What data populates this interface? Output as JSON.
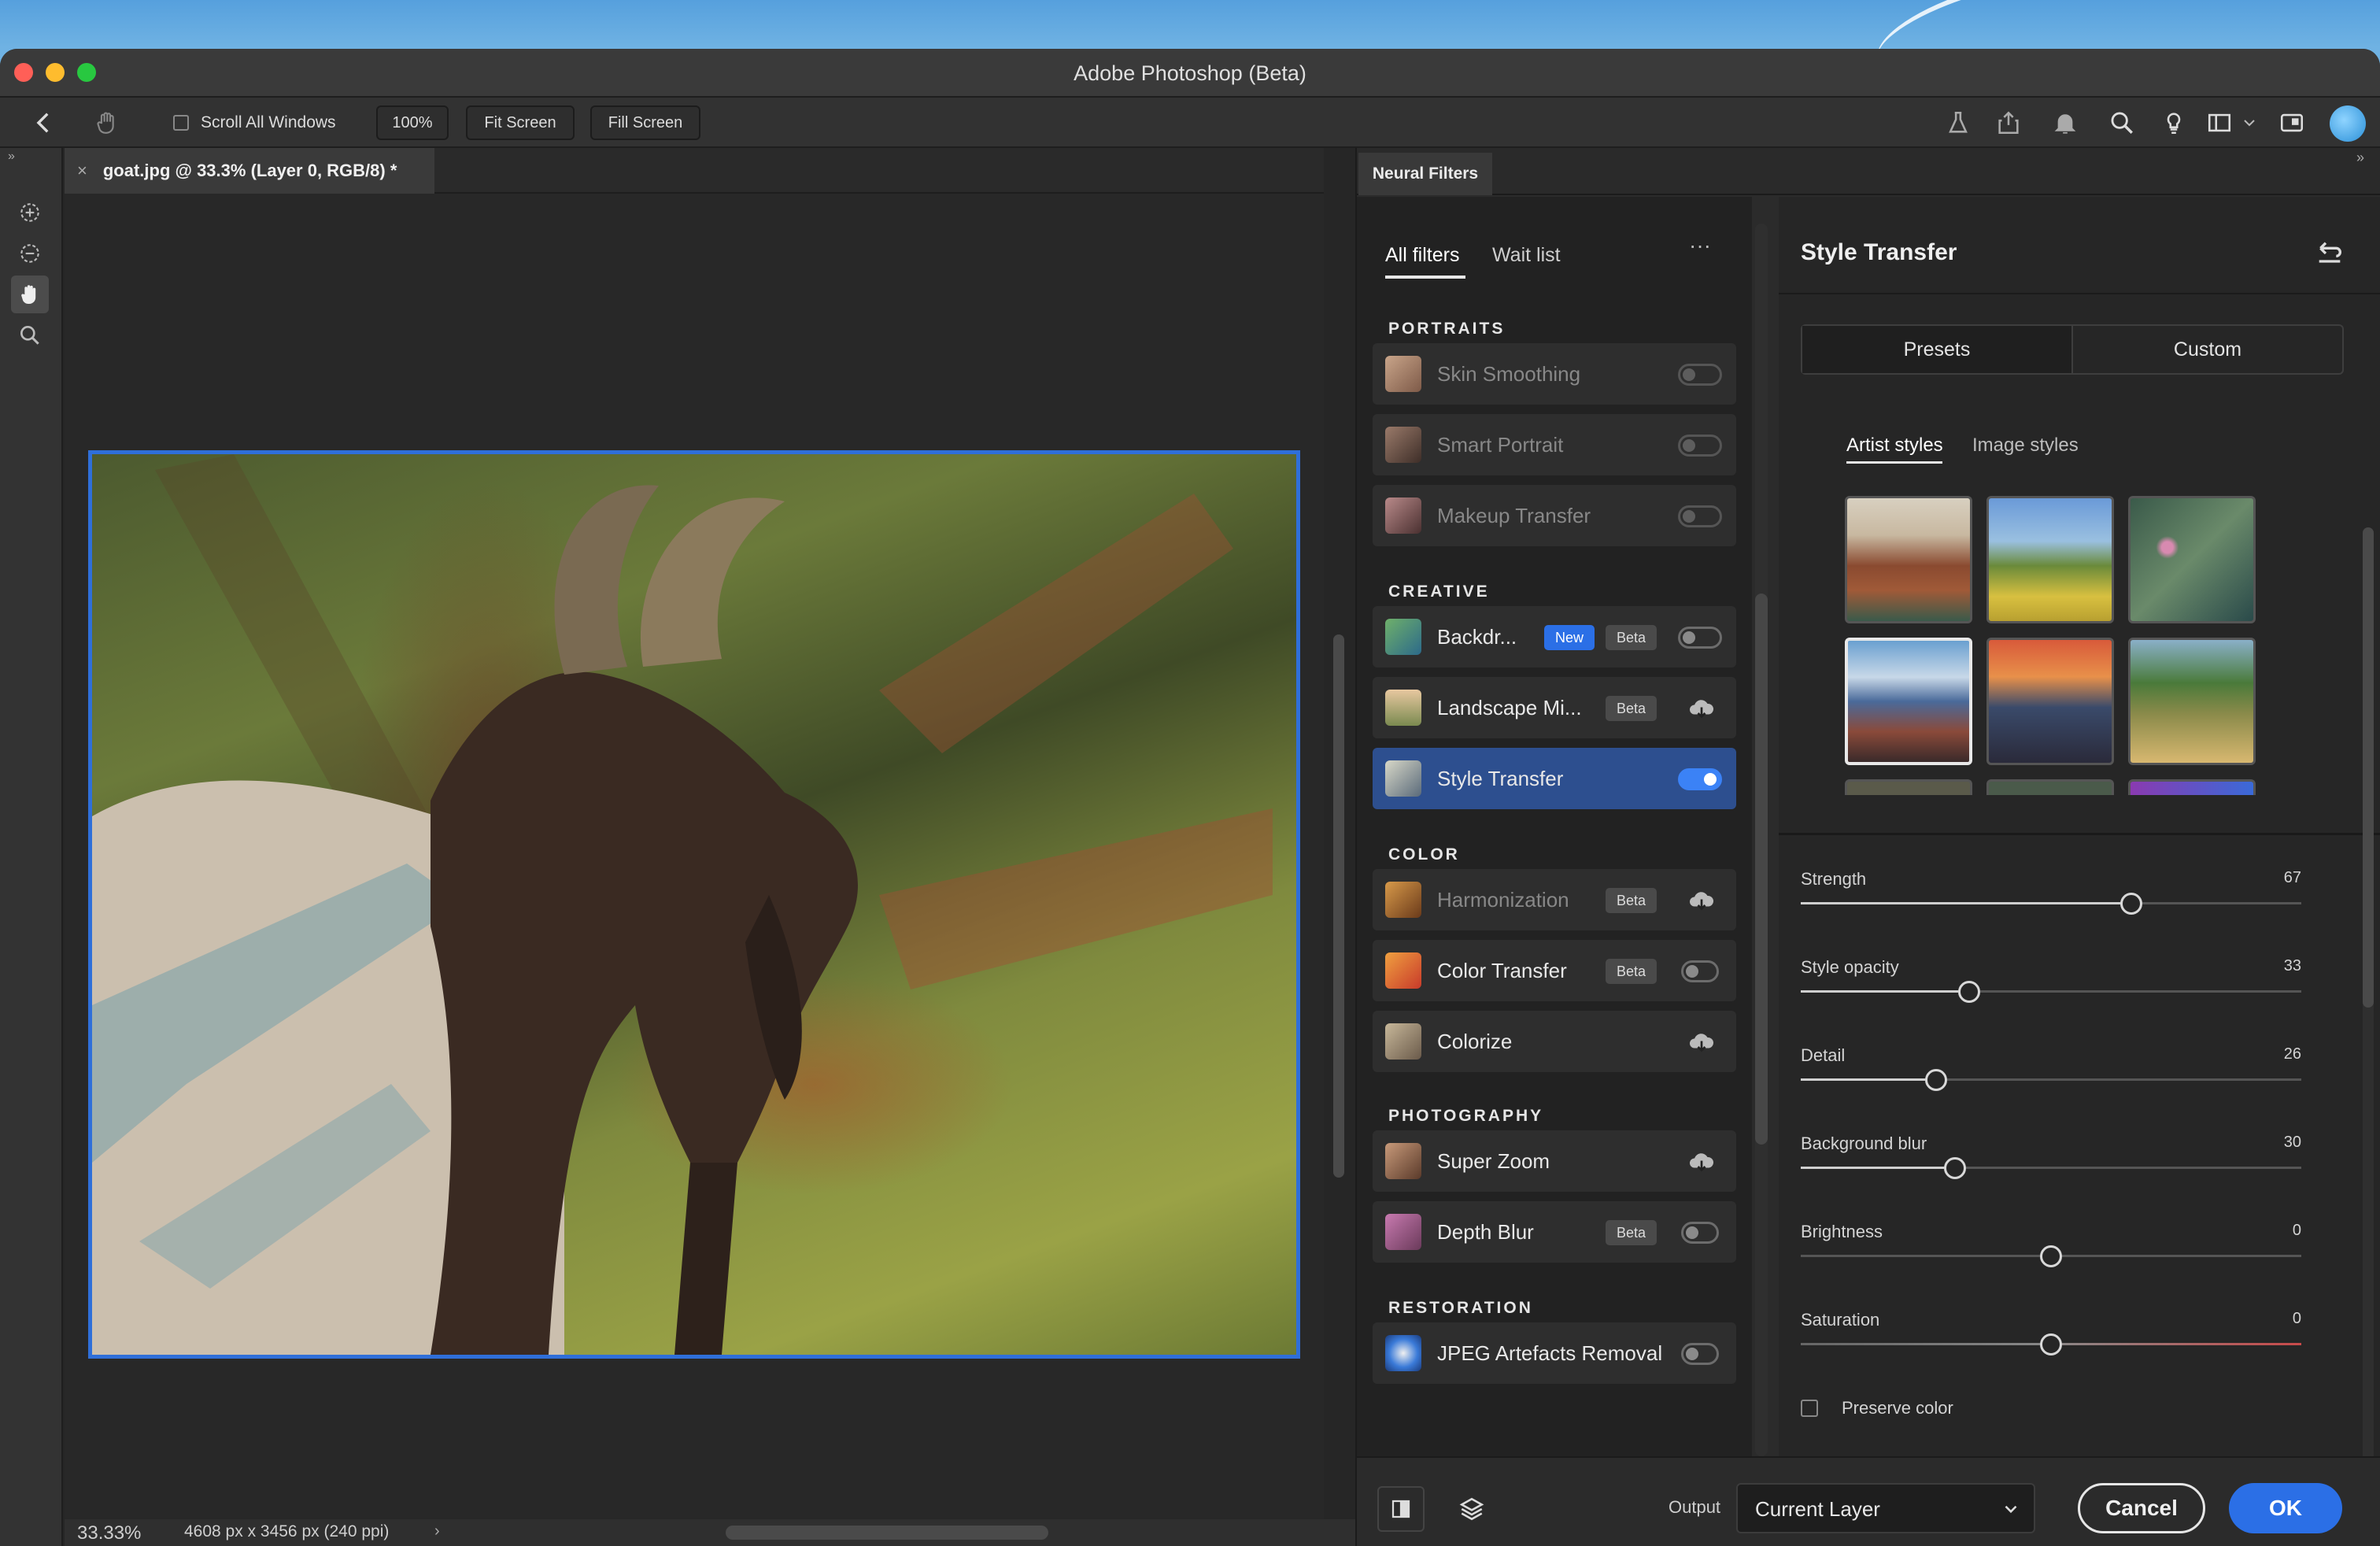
{
  "window": {
    "title": "Adobe Photoshop (Beta)"
  },
  "options_bar": {
    "scroll_all_label": "Scroll All Windows",
    "zoom_btn": "100%",
    "fit_btn": "Fit Screen",
    "fill_btn": "Fill Screen"
  },
  "document": {
    "tab_label": "goat.jpg @ 33.3% (Layer 0, RGB/8) *"
  },
  "status": {
    "zoom": "33.33%",
    "dimensions": "4608 px x 3456 px (240 ppi)"
  },
  "panel": {
    "tab": "Neural Filters",
    "list_tabs": {
      "all": "All filters",
      "wait": "Wait list"
    },
    "sections": {
      "portraits": "PORTRAITS",
      "creative": "CREATIVE",
      "color": "COLOR",
      "photography": "PHOTOGRAPHY",
      "restoration": "RESTORATION"
    },
    "filters": {
      "skin": "Skin Smoothing",
      "smart": "Smart Portrait",
      "makeup": "Makeup Transfer",
      "backdrop": "Backdr...",
      "landscape": "Landscape Mi...",
      "style": "Style Transfer",
      "harmonization": "Harmonization",
      "colortransfer": "Color Transfer",
      "colorize": "Colorize",
      "superzoom": "Super Zoom",
      "depthblur": "Depth Blur",
      "jpeg": "JPEG Artefacts Removal"
    },
    "badges": {
      "new": "New",
      "beta": "Beta"
    },
    "style_settings": {
      "title": "Style Transfer",
      "presets": "Presets",
      "custom": "Custom",
      "artist_styles": "Artist styles",
      "image_styles": "Image styles",
      "sliders": {
        "strength": {
          "label": "Strength",
          "value": "67"
        },
        "opacity": {
          "label": "Style opacity",
          "value": "33"
        },
        "detail": {
          "label": "Detail",
          "value": "26"
        },
        "blur": {
          "label": "Background blur",
          "value": "30"
        },
        "brightness": {
          "label": "Brightness",
          "value": "0"
        },
        "saturation": {
          "label": "Saturation",
          "value": "0"
        }
      },
      "preserve_color": "Preserve color"
    },
    "footer": {
      "output_label": "Output",
      "output_value": "Current Layer",
      "cancel": "Cancel",
      "ok": "OK"
    }
  },
  "colors": {
    "accent": "#2f6fd9",
    "selected_row": "#2d4f8f",
    "ok_button": "#2b6fe6"
  }
}
